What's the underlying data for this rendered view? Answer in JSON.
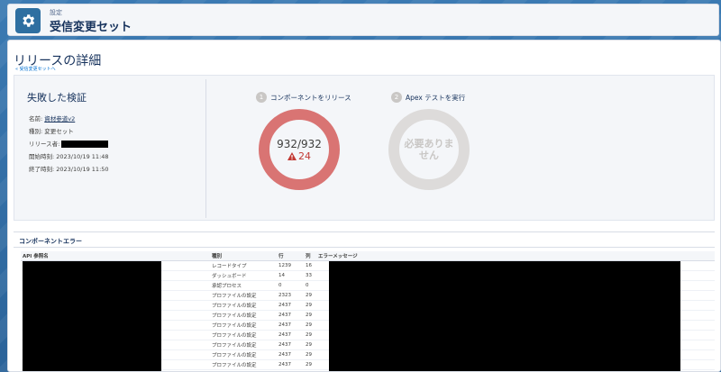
{
  "header": {
    "breadcrumb": "設定",
    "title": "受信変更セット",
    "icon": "gear-icon"
  },
  "page": {
    "title": "リリースの詳細",
    "back_link": "« 受信変更セットへ"
  },
  "summary": {
    "status": "失敗した検証",
    "name_label": "名前: ",
    "name_value": "資材参道v2",
    "type_label": "種別: ",
    "type_value": "変更セット",
    "releaser_label": "リリース者: ",
    "start_label": "開始時刻: ",
    "start_value": "2023/10/19 11:48",
    "end_label": "終了時刻: ",
    "end_value": "2023/10/19 11:50"
  },
  "steps": [
    {
      "number": "1",
      "label": "コンポーネントをリリース",
      "count": "932/932",
      "errors": "24"
    },
    {
      "number": "2",
      "label": "Apex テストを実行",
      "placeholder": "必要ありません"
    }
  ],
  "errors_section": {
    "title": "コンポーネントエラー",
    "columns": [
      "API 参照名",
      "種別",
      "行",
      "列",
      "エラーメッセージ"
    ],
    "rows": [
      {
        "type": "レコードタイプ",
        "line": "1239",
        "col": "16"
      },
      {
        "type": "ダッシュボード",
        "line": "14",
        "col": "33"
      },
      {
        "type": "承認プロセス",
        "line": "0",
        "col": "0"
      },
      {
        "type": "プロファイルの設定",
        "line": "2323",
        "col": "29"
      },
      {
        "type": "プロファイルの設定",
        "line": "2437",
        "col": "29"
      },
      {
        "type": "プロファイルの設定",
        "line": "2437",
        "col": "29"
      },
      {
        "type": "プロファイルの設定",
        "line": "2437",
        "col": "29"
      },
      {
        "type": "プロファイルの設定",
        "line": "2437",
        "col": "29"
      },
      {
        "type": "プロファイルの設定",
        "line": "2437",
        "col": "29"
      },
      {
        "type": "プロファイルの設定",
        "line": "2437",
        "col": "29"
      },
      {
        "type": "プロファイルの設定",
        "line": "2437",
        "col": "29"
      },
      {
        "type": "プロファイルの設定",
        "line": "2437",
        "col": "29"
      }
    ]
  },
  "colors": {
    "ring_error": "#d97473",
    "ring_inactive": "#dddbda",
    "error_text": "#c23934",
    "icon_bg": "#2e6fa1"
  }
}
